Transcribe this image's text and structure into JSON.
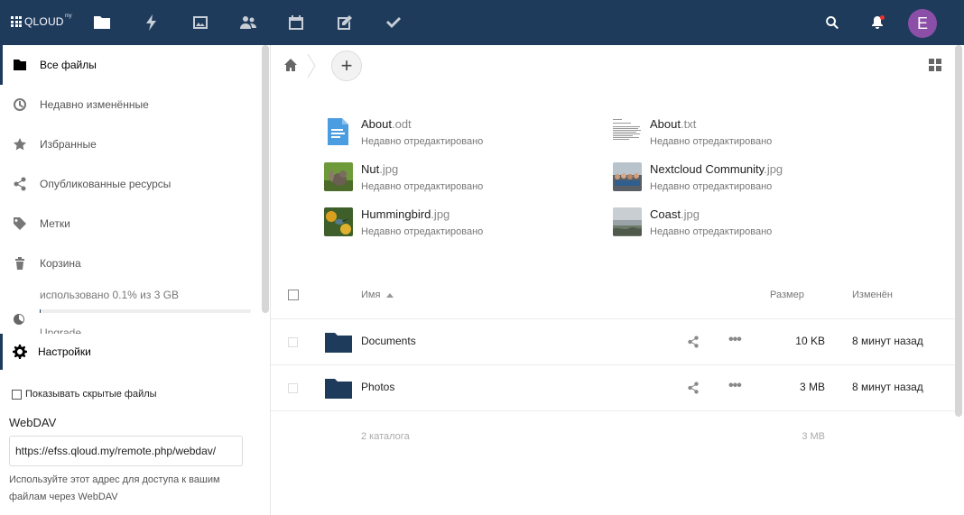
{
  "header": {
    "logo_text": "QLOUD",
    "logo_sup": "my",
    "avatar_letter": "E",
    "apps": [
      "files-icon",
      "activity-icon",
      "gallery-icon",
      "contacts-icon",
      "calendar-icon",
      "notes-icon",
      "tasks-icon"
    ]
  },
  "sidebar": {
    "items": [
      {
        "label": "Все файлы",
        "icon": "folder-icon"
      },
      {
        "label": "Недавно изменённые",
        "icon": "clock-icon"
      },
      {
        "label": "Избранные",
        "icon": "star-icon"
      },
      {
        "label": "Опубликованные ресурсы",
        "icon": "share-icon"
      },
      {
        "label": "Метки",
        "icon": "tag-icon"
      },
      {
        "label": "Корзина",
        "icon": "trash-icon"
      }
    ],
    "quota": {
      "prefix": "использовано ",
      "used": "0.1%",
      "suffix": " из 3 GB",
      "fraction": 0.001
    },
    "upgrade_label": "Upgrade",
    "settings_label": "Настройки",
    "show_hidden_label": "Показывать скрытые файлы",
    "webdav_title": "WebDAV",
    "webdav_url": "https://efss.qloud.my/remote.php/webdav/",
    "webdav_help": "Используйте этот адрес для доступа к вашим файлам через WebDAV"
  },
  "main": {
    "add_label": "+",
    "recent": [
      {
        "base": "About",
        "ext": ".odt",
        "sub": "Недавно отредактировано",
        "thumb": "document-icon"
      },
      {
        "base": "About",
        "ext": ".txt",
        "sub": "Недавно отредактировано",
        "thumb": "text-preview"
      },
      {
        "base": "Nut",
        "ext": ".jpg",
        "sub": "Недавно отредактировано",
        "thumb": "squirrel-photo"
      },
      {
        "base": "Nextcloud Community",
        "ext": ".jpg",
        "sub": "Недавно отредактировано",
        "thumb": "crowd-photo"
      },
      {
        "base": "Hummingbird",
        "ext": ".jpg",
        "sub": "Недавно отредактировано",
        "thumb": "bird-photo"
      },
      {
        "base": "Coast",
        "ext": ".jpg",
        "sub": "Недавно отредактировано",
        "thumb": "coast-photo"
      }
    ],
    "columns": {
      "name": "Имя",
      "size": "Размер",
      "modified": "Изменён"
    },
    "rows": [
      {
        "name": "Documents",
        "size": "10 KB",
        "modified": "8 минут назад"
      },
      {
        "name": "Photos",
        "size": "3 MB",
        "modified": "8 минут назад"
      }
    ],
    "summary": {
      "count": "2 каталога",
      "size": "3 MB"
    }
  },
  "colors": {
    "header_bg": "#1f3b5c",
    "folder": "#1f3b5c",
    "avatar": "#8c4fa8",
    "doc_blue": "#4a9de1"
  }
}
